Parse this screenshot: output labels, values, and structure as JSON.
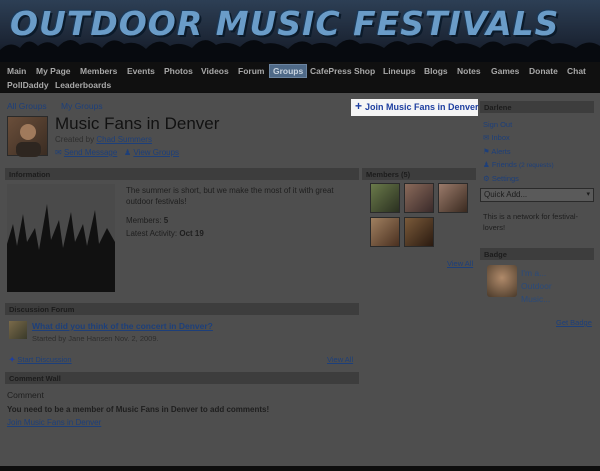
{
  "header": {
    "title": "OUTDOOR MUSIC FESTIVALS"
  },
  "nav": {
    "items": [
      "Main",
      "My Page",
      "Members",
      "Events",
      "Photos",
      "Videos",
      "Forum",
      "Groups",
      "CafePress Shop",
      "Lineups",
      "Blogs",
      "Notes",
      "Games",
      "Donate",
      "Chat",
      "PollDaddy",
      "Leaderboards"
    ],
    "active": "Groups"
  },
  "top_links": {
    "all_groups": "All Groups",
    "my_groups": "My Groups"
  },
  "join_top": "Join Music Fans in Denver",
  "group": {
    "title": "Music Fans in Denver",
    "created_by_label": "Created by",
    "creator": "Chad Summers",
    "send_message": "Send Message",
    "view_groups": "View Groups"
  },
  "information": {
    "header": "Information",
    "description": "The summer is short, but we make the most of it with great outdoor festivals!",
    "members_label": "Members:",
    "members_value": "5",
    "activity_label": "Latest Activity:",
    "activity_value": "Oct 19"
  },
  "members_box": {
    "header": "Members (5)",
    "view_all": "View All"
  },
  "discussion": {
    "header": "Discussion Forum",
    "topic_title": "What did you think of the concert in Denver?",
    "topic_meta": "Started by Jane Hansen Nov. 2, 2009.",
    "start_discussion": "Start Discussion",
    "view_all": "View All"
  },
  "comment_wall": {
    "header": "Comment Wall",
    "label": "Comment",
    "notice": "You need to be a member of Music Fans in Denver to add comments!",
    "join_link": "Join Music Fans in Denver"
  },
  "sidebar": {
    "user": "Darlene",
    "sign_out": "Sign Out",
    "inbox": "Inbox",
    "alerts": "Alerts",
    "friends": "Friends",
    "friends_requests": "(2 requests)",
    "settings": "Settings",
    "quick_add": "Quick Add...",
    "network_desc": "This is a network for festival-lovers!",
    "badge_header": "Badge",
    "badge_text_line1": "I'm a...",
    "badge_text_line2": "Outdoor",
    "badge_text_line3": "Music...",
    "get_badge": "Get Badge"
  }
}
